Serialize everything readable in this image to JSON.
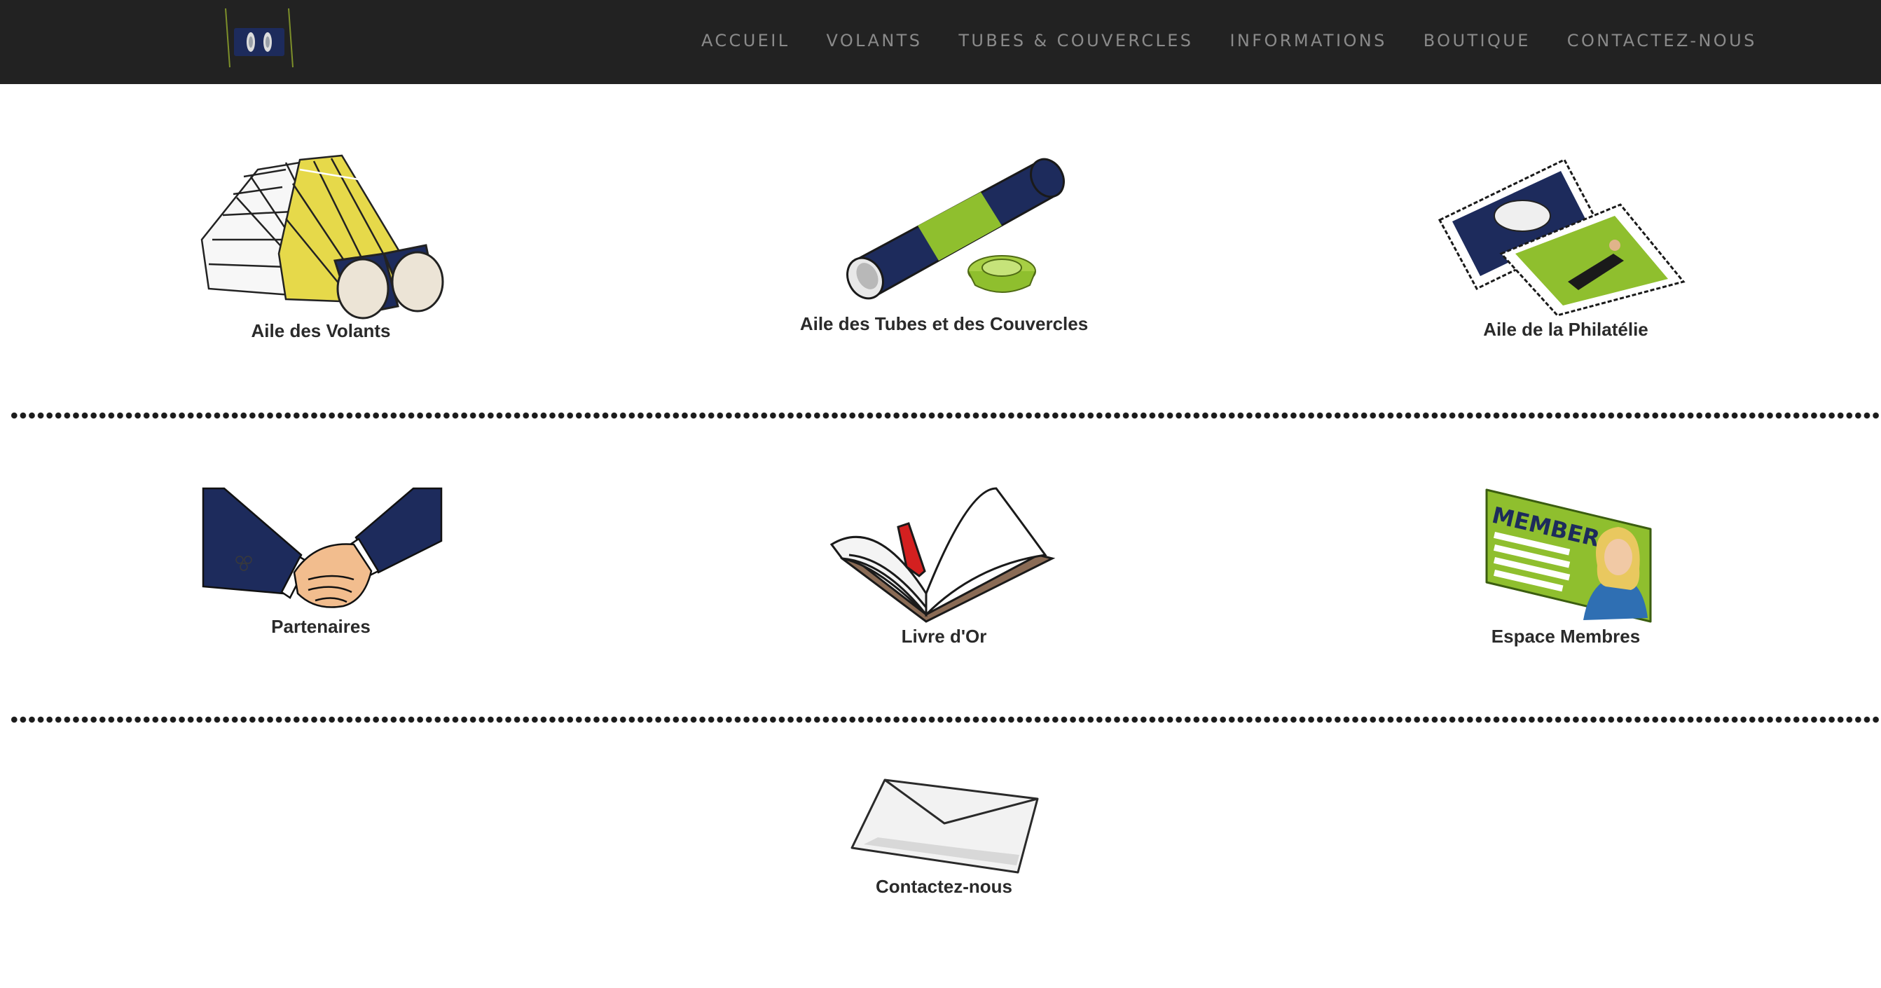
{
  "nav": {
    "items": [
      {
        "label": "ACCUEIL"
      },
      {
        "label": "VOLANTS"
      },
      {
        "label": "TUBES & COUVERCLES"
      },
      {
        "label": "INFORMATIONS"
      },
      {
        "label": "BOUTIQUE"
      },
      {
        "label": "CONTACTEZ-NOUS"
      }
    ]
  },
  "tiles": [
    {
      "label": "Aile des Volants",
      "icon": "shuttlecock-icon"
    },
    {
      "label": "Aile des Tubes et des Couvercles",
      "icon": "tube-and-lid-icon"
    },
    {
      "label": "Aile de la Philatélie",
      "icon": "stamps-icon"
    },
    {
      "label": "Partenaires",
      "icon": "handshake-icon"
    },
    {
      "label": "Livre d'Or",
      "icon": "open-book-icon"
    },
    {
      "label": "Espace Membres",
      "icon": "member-card-icon"
    },
    {
      "label": "Contactez-nous",
      "icon": "envelope-icon"
    }
  ],
  "member_card": {
    "text": "MEMBER"
  },
  "colors": {
    "header_bg": "#222222",
    "nav_text": "#8a8a8a",
    "navy": "#1d2b5c",
    "lime": "#8fbf2e",
    "label_text": "#2a2a2a",
    "divider_dots": "#1c1c1c"
  }
}
